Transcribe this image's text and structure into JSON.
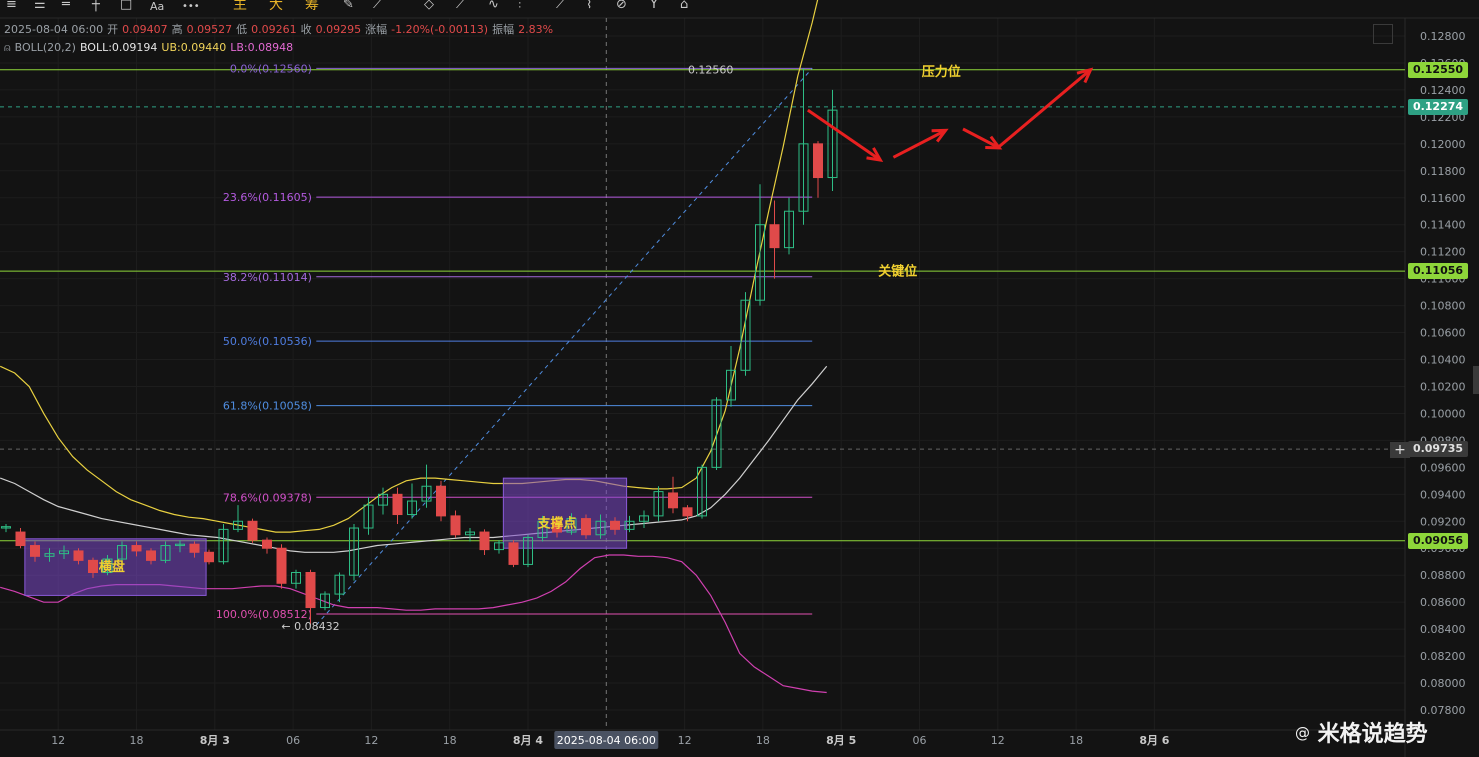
{
  "toolbar": {
    "icons": [
      "menu-icon",
      "list-icon",
      "line-icon",
      "rectangle-icon",
      "text-icon",
      "more-icon",
      "pencil-icon",
      "ruler-icon",
      "draw-icon",
      "brush-icon",
      "shape-icon",
      "ray-icon",
      "fork-icon",
      "trash-icon"
    ],
    "text_label": "Aa",
    "more_label": "•••",
    "tabs": [
      "主",
      "大",
      "筹"
    ]
  },
  "info": {
    "date": "2025-08-04 06:00",
    "open_label": "开",
    "open": "0.09407",
    "high_label": "高",
    "high": "0.09527",
    "low_label": "低",
    "low": "0.09261",
    "close_label": "收",
    "close": "0.09295",
    "change_label": "涨幅",
    "change": "-1.20%(-0.00113)",
    "amp_label": "振幅",
    "amp": "2.83%",
    "boll_name": "BOLL(20,2)",
    "boll": "BOLL:0.09194",
    "ub": "UB:0.09440",
    "lb": "LB:0.08948"
  },
  "badges": [
    {
      "text": "0.12550",
      "color": "#8ed63a"
    },
    {
      "text": "0.12274",
      "color": "#2ea184"
    },
    {
      "text": "0.11056",
      "color": "#8ed63a"
    },
    {
      "text": "0.09735",
      "color": "#3a3a3a"
    },
    {
      "text": "0.09056",
      "color": "#8ed63a"
    }
  ],
  "watermark": {
    "at": "@",
    "text": "米格说趋势"
  },
  "crosshair_plus": "+",
  "chart_data": {
    "type": "candlestick",
    "y_ticks": [
      "0.12800",
      "0.12600",
      "0.12400",
      "0.12200",
      "0.12000",
      "0.11800",
      "0.11600",
      "0.11400",
      "0.11200",
      "0.11000",
      "0.10800",
      "0.10600",
      "0.10400",
      "0.10200",
      "0.10000",
      "0.09800",
      "0.09600",
      "0.09400",
      "0.09200",
      "0.09000",
      "0.08800",
      "0.08600",
      "0.08400",
      "0.08200",
      "0.08000",
      "0.07800"
    ],
    "y_tick_values": [
      0.128,
      0.126,
      0.124,
      0.122,
      0.12,
      0.118,
      0.116,
      0.114,
      0.112,
      0.11,
      0.108,
      0.106,
      0.104,
      0.102,
      0.1,
      0.098,
      0.096,
      0.094,
      0.092,
      0.09,
      0.088,
      0.086,
      0.084,
      0.082,
      0.08,
      0.078
    ],
    "x_ticks": [
      {
        "label": "12",
        "i": 3.6
      },
      {
        "label": "18",
        "i": 9.0
      },
      {
        "label": "8月 3",
        "i": 14.4
      },
      {
        "label": "06",
        "i": 19.8
      },
      {
        "label": "12",
        "i": 25.2
      },
      {
        "label": "18",
        "i": 30.6
      },
      {
        "label": "8月 4",
        "i": 36.0
      },
      {
        "label": "12",
        "i": 46.8
      },
      {
        "label": "18",
        "i": 52.2
      },
      {
        "label": "8月 5",
        "i": 57.6
      },
      {
        "label": "06",
        "i": 63.0
      },
      {
        "label": "12",
        "i": 68.4
      },
      {
        "label": "18",
        "i": 73.8
      },
      {
        "label": "8月 6",
        "i": 79.2
      }
    ],
    "crosshair_label": "2025-08-04 06:00",
    "crosshair_i": 41.4,
    "crosshair_y": 0.09735,
    "candles": [
      [
        0.0915,
        0.0916,
        0.0912,
        0.0918
      ],
      [
        0.0912,
        0.0902,
        0.09,
        0.0915
      ],
      [
        0.0902,
        0.0894,
        0.089,
        0.0905
      ],
      [
        0.0894,
        0.0896,
        0.089,
        0.09
      ],
      [
        0.0896,
        0.0898,
        0.0892,
        0.0902
      ],
      [
        0.0898,
        0.0891,
        0.0888,
        0.09
      ],
      [
        0.0891,
        0.0882,
        0.0878,
        0.0893
      ],
      [
        0.0882,
        0.0892,
        0.088,
        0.0895
      ],
      [
        0.0892,
        0.0902,
        0.0888,
        0.0905
      ],
      [
        0.0902,
        0.0898,
        0.0894,
        0.0905
      ],
      [
        0.0898,
        0.0891,
        0.0888,
        0.09
      ],
      [
        0.0891,
        0.0902,
        0.0889,
        0.0905
      ],
      [
        0.0902,
        0.0903,
        0.0897,
        0.0906
      ],
      [
        0.0903,
        0.0897,
        0.0893,
        0.0905
      ],
      [
        0.0897,
        0.089,
        0.0888,
        0.0899
      ],
      [
        0.089,
        0.0914,
        0.0888,
        0.0918
      ],
      [
        0.0914,
        0.092,
        0.0912,
        0.0932
      ],
      [
        0.092,
        0.0906,
        0.0904,
        0.0922
      ],
      [
        0.0906,
        0.09,
        0.0896,
        0.0908
      ],
      [
        0.09,
        0.0874,
        0.087,
        0.0903
      ],
      [
        0.0874,
        0.0882,
        0.087,
        0.0884
      ],
      [
        0.0882,
        0.0856,
        0.0843,
        0.0884
      ],
      [
        0.0856,
        0.0866,
        0.0854,
        0.0868
      ],
      [
        0.0866,
        0.088,
        0.086,
        0.0882
      ],
      [
        0.088,
        0.0915,
        0.0876,
        0.0918
      ],
      [
        0.0915,
        0.0932,
        0.091,
        0.0938
      ],
      [
        0.0932,
        0.094,
        0.0925,
        0.0945
      ],
      [
        0.094,
        0.0925,
        0.0918,
        0.0945
      ],
      [
        0.0925,
        0.0935,
        0.0922,
        0.0948
      ],
      [
        0.0935,
        0.0946,
        0.093,
        0.0962
      ],
      [
        0.0946,
        0.0924,
        0.092,
        0.095
      ],
      [
        0.0924,
        0.091,
        0.0908,
        0.0928
      ],
      [
        0.091,
        0.0912,
        0.0905,
        0.0915
      ],
      [
        0.0912,
        0.0899,
        0.0895,
        0.0914
      ],
      [
        0.0899,
        0.0904,
        0.0896,
        0.0906
      ],
      [
        0.0904,
        0.0888,
        0.0886,
        0.0906
      ],
      [
        0.0888,
        0.0908,
        0.0886,
        0.091
      ],
      [
        0.0908,
        0.092,
        0.0905,
        0.0924
      ],
      [
        0.092,
        0.0912,
        0.0908,
        0.0924
      ],
      [
        0.0912,
        0.0922,
        0.091,
        0.0926
      ],
      [
        0.0922,
        0.091,
        0.0907,
        0.0925
      ],
      [
        0.091,
        0.092,
        0.0907,
        0.0925
      ],
      [
        0.092,
        0.0914,
        0.091,
        0.0923
      ],
      [
        0.0914,
        0.092,
        0.0912,
        0.0924
      ],
      [
        0.092,
        0.0924,
        0.0915,
        0.0928
      ],
      [
        0.0924,
        0.0942,
        0.092,
        0.0946
      ],
      [
        0.0941,
        0.093,
        0.0926,
        0.0953
      ],
      [
        0.093,
        0.0924,
        0.092,
        0.0932
      ],
      [
        0.0924,
        0.096,
        0.0922,
        0.0962
      ],
      [
        0.096,
        0.101,
        0.0958,
        0.1012
      ],
      [
        0.101,
        0.1032,
        0.1005,
        0.105
      ],
      [
        0.1032,
        0.1084,
        0.1028,
        0.109
      ],
      [
        0.1084,
        0.114,
        0.108,
        0.117
      ],
      [
        0.114,
        0.1123,
        0.11,
        0.1158
      ],
      [
        0.1123,
        0.115,
        0.1118,
        0.116
      ],
      [
        0.115,
        0.12,
        0.114,
        0.1256
      ],
      [
        0.12,
        0.1175,
        0.116,
        0.1202
      ],
      [
        0.1175,
        0.1225,
        0.1165,
        0.124
      ]
    ],
    "boll_upper": [
      0.1035,
      0.103,
      0.102,
      0.1,
      0.0982,
      0.0968,
      0.0958,
      0.095,
      0.0942,
      0.0936,
      0.0932,
      0.0928,
      0.0925,
      0.0923,
      0.0922,
      0.092,
      0.0918,
      0.0916,
      0.0914,
      0.0912,
      0.0912,
      0.0913,
      0.0914,
      0.0917,
      0.0922,
      0.093,
      0.0938,
      0.0945,
      0.095,
      0.0952,
      0.0952,
      0.0951,
      0.095,
      0.0949,
      0.0948,
      0.0948,
      0.0948,
      0.0949,
      0.095,
      0.0951,
      0.0951,
      0.095,
      0.0948,
      0.0946,
      0.0945,
      0.0944,
      0.0944,
      0.0945,
      0.0952,
      0.0972,
      0.1002,
      0.1048,
      0.11,
      0.115,
      0.1198,
      0.125,
      0.129,
      0.1335
    ],
    "boll_mid": [
      0.0952,
      0.0948,
      0.0942,
      0.0936,
      0.0931,
      0.0928,
      0.0925,
      0.0922,
      0.092,
      0.0918,
      0.0916,
      0.0914,
      0.0912,
      0.091,
      0.0909,
      0.0908,
      0.0906,
      0.0904,
      0.0902,
      0.09,
      0.0898,
      0.0897,
      0.0897,
      0.0897,
      0.0898,
      0.09,
      0.0902,
      0.0903,
      0.0904,
      0.0905,
      0.0906,
      0.0907,
      0.0908,
      0.0908,
      0.0908,
      0.0909,
      0.091,
      0.0911,
      0.0912,
      0.0913,
      0.0914,
      0.0915,
      0.0916,
      0.0917,
      0.0918,
      0.0919,
      0.092,
      0.0921,
      0.0924,
      0.093,
      0.094,
      0.0952,
      0.0966,
      0.098,
      0.0995,
      0.101,
      0.1022,
      0.1035
    ],
    "boll_lower": [
      0.0871,
      0.0868,
      0.0864,
      0.086,
      0.086,
      0.0866,
      0.087,
      0.0872,
      0.0873,
      0.0873,
      0.0873,
      0.0873,
      0.0872,
      0.0871,
      0.087,
      0.087,
      0.087,
      0.0871,
      0.0872,
      0.0872,
      0.087,
      0.0866,
      0.0862,
      0.0858,
      0.0856,
      0.0856,
      0.0856,
      0.0855,
      0.0854,
      0.0854,
      0.0855,
      0.0855,
      0.0855,
      0.0855,
      0.0856,
      0.0858,
      0.086,
      0.0863,
      0.0868,
      0.0875,
      0.0885,
      0.0893,
      0.0895,
      0.0895,
      0.0894,
      0.0894,
      0.0893,
      0.089,
      0.088,
      0.0865,
      0.0845,
      0.0822,
      0.0812,
      0.0805,
      0.0798,
      0.0796,
      0.0794,
      0.0793
    ],
    "fib_levels": [
      {
        "label": "0.0%(0.12560)",
        "value": 0.1256,
        "color": "#8b64d6"
      },
      {
        "label": "23.6%(0.11605)",
        "value": 0.11605,
        "color": "#b45ae0"
      },
      {
        "label": "38.2%(0.11014)",
        "value": 0.11014,
        "color": "#a46adc"
      },
      {
        "label": "50.0%(0.10536)",
        "value": 0.10536,
        "color": "#4f7de0"
      },
      {
        "label": "61.8%(0.10058)",
        "value": 0.10058,
        "color": "#4f8de0"
      },
      {
        "label": "78.6%(0.09378)",
        "value": 0.09378,
        "color": "#d050c8"
      },
      {
        "label": "100.0%(0.08512)",
        "value": 0.08512,
        "color": "#e050b0"
      }
    ],
    "h_lines": [
      {
        "value": 0.1255,
        "style": "solid",
        "color": "#8ed63a"
      },
      {
        "value": 0.12274,
        "style": "dashed",
        "color": "#2ea184"
      },
      {
        "value": 0.11056,
        "style": "solid",
        "color": "#8ed63a"
      },
      {
        "value": 0.09735,
        "style": "dashed",
        "color": "#666666"
      },
      {
        "value": 0.09056,
        "style": "solid",
        "color": "#8ed63a"
      }
    ],
    "annotations": [
      {
        "text": "压力位",
        "i": 64.5,
        "y": 0.1254,
        "color": "#f0d030"
      },
      {
        "text": "关键位",
        "i": 61.5,
        "y": 0.1106,
        "color": "#f0d030"
      },
      {
        "text": "横盘",
        "i": 7.3,
        "y": 0.0887,
        "color": "#f0d030"
      },
      {
        "text": "支撑点",
        "i": 38.0,
        "y": 0.0919,
        "color": "#f0d030"
      },
      {
        "text": "0.12560",
        "i": 48.6,
        "y": 0.1256,
        "color": "#cccccc"
      },
      {
        "text": "← 0.08432",
        "i": 21.0,
        "y": 0.0843,
        "color": "#cccccc"
      }
    ],
    "boxes": [
      {
        "name": "横盘",
        "i0": 1.3,
        "i1": 13.8,
        "y0": 0.0865,
        "y1": 0.0907
      },
      {
        "name": "支撑点",
        "i0": 34.3,
        "i1": 42.8,
        "y0": 0.09,
        "y1": 0.0952
      }
    ],
    "arrows": [
      [
        [
          55.3,
          0.1225
        ],
        [
          60.3,
          0.1188
        ]
      ],
      [
        [
          61.2,
          0.119
        ],
        [
          64.8,
          0.121
        ]
      ],
      [
        [
          66.0,
          0.1211
        ],
        [
          68.5,
          0.1197
        ]
      ],
      [
        [
          68.5,
          0.1198
        ],
        [
          74.8,
          0.1255
        ]
      ]
    ]
  }
}
